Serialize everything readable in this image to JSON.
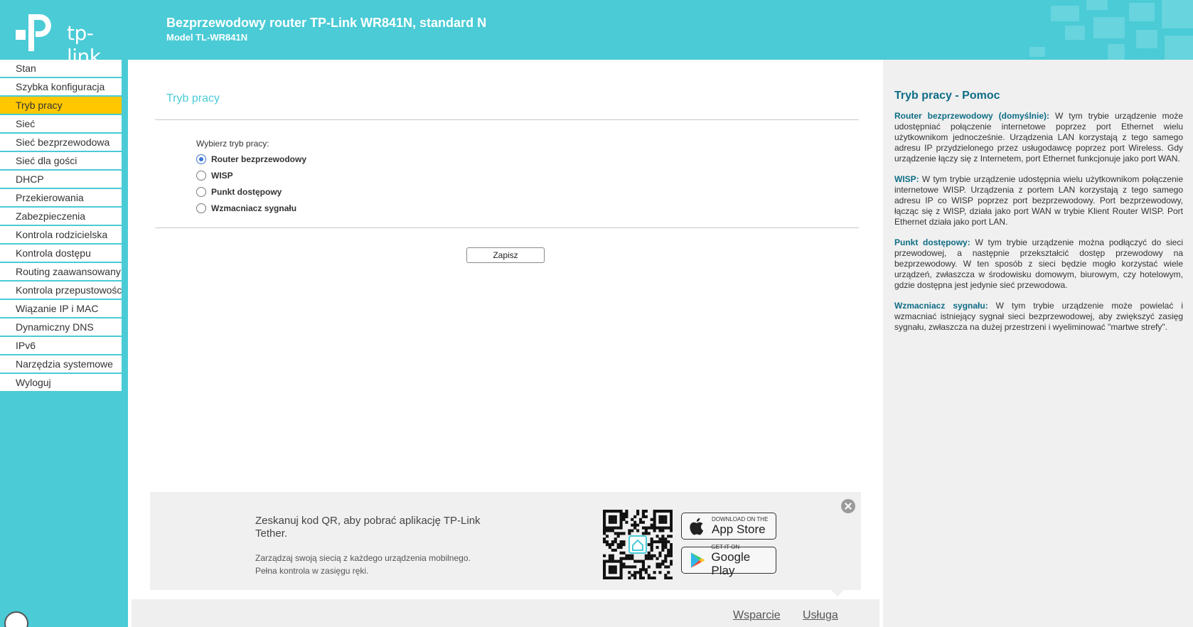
{
  "colors": {
    "brand": "#4acbd6",
    "active_menu": "#ffc700",
    "help_term": "#0e6d86",
    "radio_checked": "#3b76d4"
  },
  "header": {
    "logo_text": "tp-link",
    "title": "Bezprzewodowy router TP-Link WR841N, standard N",
    "model": "Model TL-WR841N"
  },
  "sidebar": {
    "items": [
      {
        "label": "Stan",
        "active": false
      },
      {
        "label": "Szybka konfiguracja",
        "active": false
      },
      {
        "label": "Tryb pracy",
        "active": true
      },
      {
        "label": "Sieć",
        "active": false
      },
      {
        "label": "Sieć bezprzewodowa",
        "active": false
      },
      {
        "label": "Sieć dla gości",
        "active": false
      },
      {
        "label": "DHCP",
        "active": false
      },
      {
        "label": "Przekierowania",
        "active": false
      },
      {
        "label": "Zabezpieczenia",
        "active": false
      },
      {
        "label": "Kontrola rodzicielska",
        "active": false
      },
      {
        "label": "Kontrola dostępu",
        "active": false
      },
      {
        "label": "Routing zaawansowany",
        "active": false
      },
      {
        "label": "Kontrola przepustowośc",
        "active": false
      },
      {
        "label": "Wiązanie IP i MAC",
        "active": false
      },
      {
        "label": "Dynamiczny DNS",
        "active": false
      },
      {
        "label": "IPv6",
        "active": false
      },
      {
        "label": "Narzędzia systemowe",
        "active": false
      },
      {
        "label": "Wyloguj",
        "active": false
      }
    ]
  },
  "main": {
    "title": "Tryb pracy",
    "mode_label": "Wybierz tryb pracy:",
    "modes": [
      {
        "label": "Router bezprzewodowy",
        "checked": true
      },
      {
        "label": "WISP",
        "checked": false
      },
      {
        "label": "Punkt dostępowy",
        "checked": false
      },
      {
        "label": "Wzmacniacz sygnału",
        "checked": false
      }
    ],
    "save_label": "Zapisz"
  },
  "promo": {
    "title": "Zeskanuj kod QR, aby pobrać aplikację TP-Link Tether.",
    "subtitle_line1": "Zarządzaj swoją siecią z każdego urządzenia mobilnego.",
    "subtitle_line2": "Pełna kontrola w zasięgu ręki.",
    "app_store_small": "DOWNLOAD ON THE",
    "app_store_big": "App Store",
    "google_play_small": "GET IT ON",
    "google_play_big": "Google Play"
  },
  "footer": {
    "support": "Wsparcie",
    "service": "Usługa"
  },
  "help": {
    "title": "Tryb pracy - Pomoc",
    "sections": [
      {
        "term": "Router bezprzewodowy (domyślnie):",
        "text": " W tym trybie urządzenie może udostępniać połączenie internetowe poprzez port Ethernet wielu użytkownikom jednocześnie. Urządzenia LAN korzystają z tego samego adresu IP przydzielonego przez usługodawcę poprzez port Wireless. Gdy urządzenie łączy się z Internetem, port Ethernet funkcjonuje jako port WAN."
      },
      {
        "term": "WISP:",
        "text": " W tym trybie urządzenie udostępnia wielu użytkownikom połączenie internetowe WISP. Urządzenia z portem LAN korzystają z tego samego adresu IP co WISP poprzez port bezprzewodowy. Port bezprzewodowy, łącząc się z WISP, działa jako port WAN w trybie Klient Router WISP. Port Ethernet działa jako port LAN."
      },
      {
        "term": "Punkt dostępowy:",
        "text": " W tym trybie urządzenie można podłączyć do sieci przewodowej, a następnie przekształcić dostęp przewodowy na bezprzewodowy. W ten sposób z sieci będzie mogło korzystać wiele urządzeń, zwłaszcza w środowisku domowym, biurowym, czy hotelowym, gdzie dostępna jest jedynie sieć przewodowa."
      },
      {
        "term": "Wzmacniacz sygnału:",
        "text": " W tym trybie urządzenie może powielać i wzmacniać istniejący sygnał sieci bezprzewodowej, aby zwiększyć zasięg sygnału, zwłaszcza na dużej przestrzeni i wyeliminować \"martwe strefy\"."
      }
    ]
  }
}
